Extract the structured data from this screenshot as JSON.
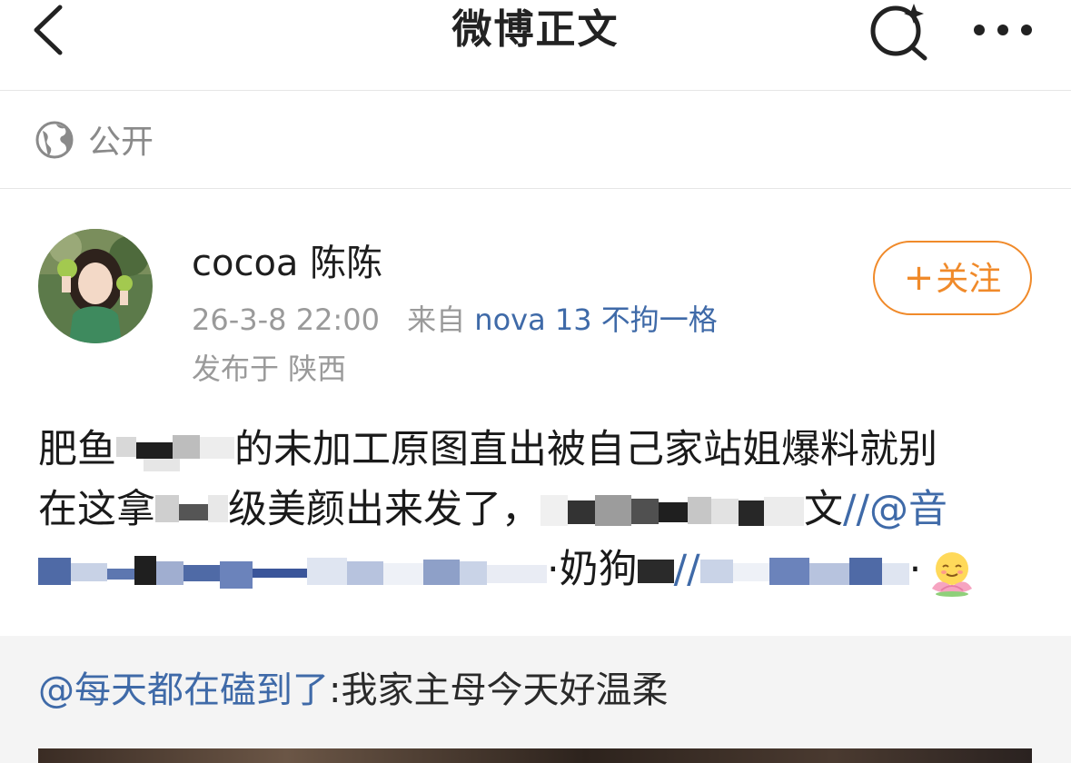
{
  "navbar": {
    "title": "微博正文",
    "back_icon": "chevron-left-icon",
    "search_icon": "sparkle-search-icon",
    "more_icon": "more-dots-icon"
  },
  "visibility": {
    "icon": "globe-icon",
    "label": "公开"
  },
  "post": {
    "author": "cocoa 陈陈",
    "date": "26-3-8 22:00",
    "source_prefix": "来自",
    "source_device": "nova 13 不拘一格",
    "location": "发布于 陕西",
    "follow_label": "关注",
    "follow_plus": "+",
    "body": {
      "line1_a": "肥鱼",
      "line1_b": "的未加工原图直出被自己家站姐爆料就别",
      "line2_a": "在这拿",
      "line2_b": "级美颜出来发了，",
      "line2_c": "文",
      "line2_mention": "//@音",
      "line3_a": "·奶狗",
      "line3_b": "//",
      "line3_c": "·"
    },
    "emoji_icon": "smiling-lotus-icon"
  },
  "repost": {
    "author": "@每天都在磕到了",
    "text": ":我家主母今天好温柔"
  },
  "colors": {
    "accent_orange": "#f08a2a",
    "link_blue": "#3f6aa8",
    "meta_gray": "#9a9a9a",
    "repost_bg": "#f4f4f4"
  }
}
